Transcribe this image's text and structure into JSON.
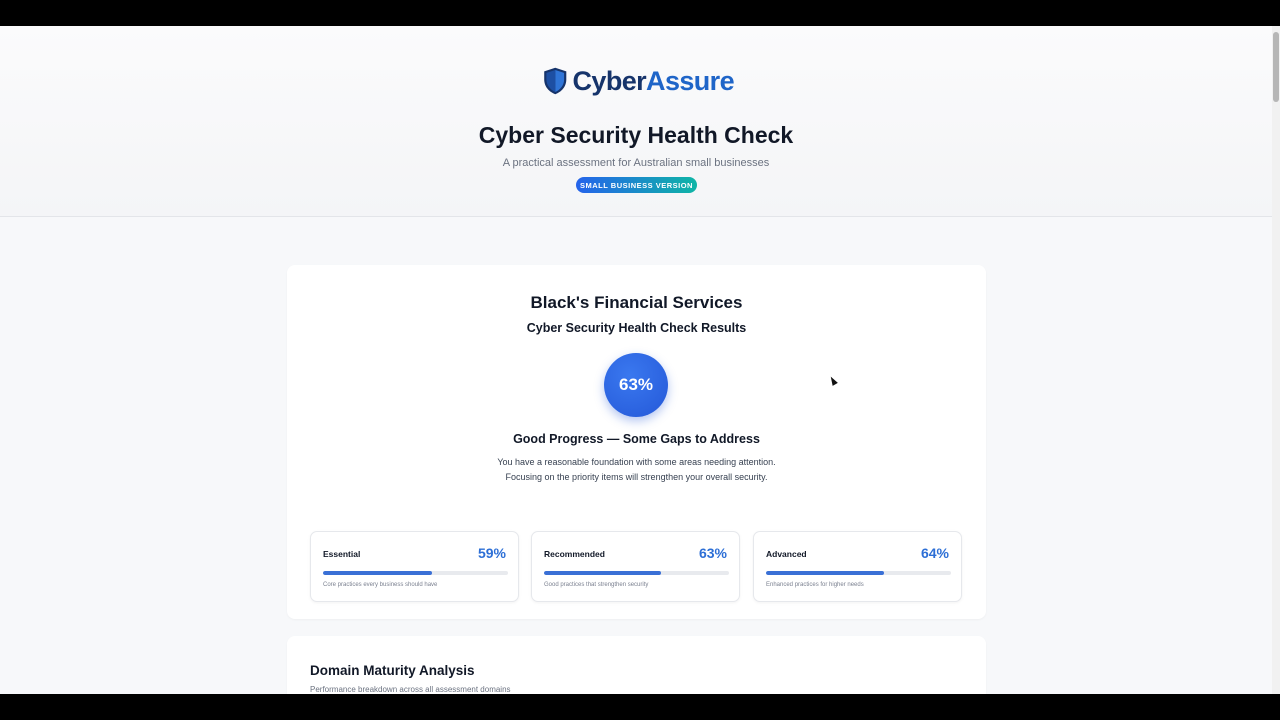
{
  "header": {
    "logo": {
      "part1": "Cyber",
      "part2": "Assure",
      "icon": "shield-icon"
    },
    "title": "Cyber Security Health Check",
    "subtitle": "A practical assessment for Australian small businesses",
    "badge": "SMALL BUSINESS VERSION"
  },
  "results": {
    "company": "Black's Financial Services",
    "title": "Cyber Security Health Check Results",
    "score_label": "63%",
    "score_value": 63,
    "status_heading": "Good Progress — Some Gaps to Address",
    "status_line1": "You have a reasonable foundation with some areas needing attention.",
    "status_line2": "Focusing on the priority items will strengthen your overall security.",
    "tiers": [
      {
        "name": "Essential",
        "percent_label": "59%",
        "percent": 59,
        "description": "Core practices every business should have"
      },
      {
        "name": "Recommended",
        "percent_label": "63%",
        "percent": 63,
        "description": "Good practices that strengthen security"
      },
      {
        "name": "Advanced",
        "percent_label": "64%",
        "percent": 64,
        "description": "Enhanced practices for higher needs"
      }
    ]
  },
  "domain": {
    "title": "Domain Maturity Analysis",
    "subtitle": "Performance breakdown across all assessment domains"
  },
  "colors": {
    "accent": "#2563eb",
    "teal": "#0fb5a6",
    "progress_fill": "#3a70d6",
    "percent_text": "#2d6fd6",
    "logo_dark": "#16346b",
    "logo_blue": "#1f65c8"
  }
}
